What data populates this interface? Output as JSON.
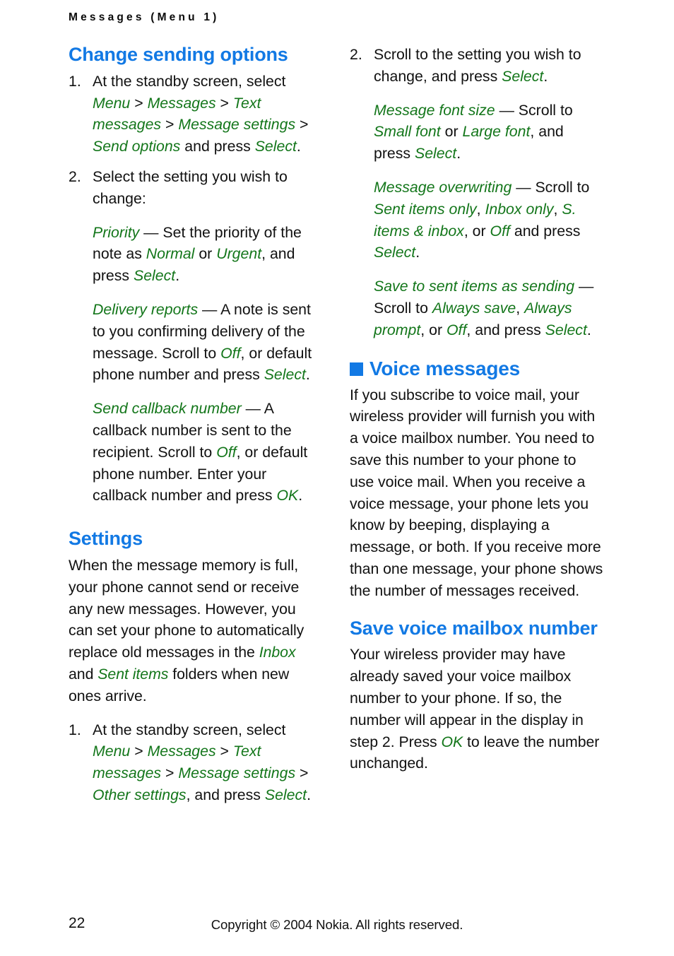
{
  "page": {
    "running_header": "Messages (Menu 1)",
    "page_number": "22",
    "copyright": "Copyright © 2004 Nokia. All rights reserved.",
    "colors": {
      "heading_blue": "#1279e4",
      "ui_term_green": "#13761a",
      "body_black": "#111111",
      "background": "#ffffff"
    }
  },
  "left_column": {
    "heading_change_sending": "Change sending options",
    "step1": {
      "number": "1.",
      "t1": "At the standby screen, select ",
      "ui1": "Menu",
      "t2": " > ",
      "ui2": "Messages",
      "t3": " > ",
      "ui3": "Text messages",
      "t4": " > ",
      "ui4": "Message settings",
      "t5": " > ",
      "ui5": "Send options",
      "t6": " and press ",
      "ui6": "Select",
      "t7": "."
    },
    "step2": {
      "number": "2.",
      "t1": "Select the setting you wish to change:"
    },
    "priority": {
      "term": "Priority",
      "t1": " — Set the priority of the note as ",
      "ui1": "Normal",
      "t2": " or ",
      "ui2": "Urgent",
      "t3": ", and press ",
      "ui3": "Select",
      "t4": "."
    },
    "delivery_reports": {
      "term": "Delivery reports",
      "t1": " — A note is sent to you confirming delivery of the message. Scroll to ",
      "ui1": "Off",
      "t2": ", or default phone number and press ",
      "ui2": "Select",
      "t3": "."
    },
    "send_callback": {
      "term": "Send callback number",
      "t1": " — A callback number is sent to the recipient. Scroll to ",
      "ui1": "Off",
      "t2": ",  or default phone number. Enter your callback number and press ",
      "ui2": "OK",
      "t3": "."
    },
    "heading_settings": "Settings",
    "settings_para": {
      "t1": "When the message memory is full, your phone cannot send or receive any new messages. However, you can set your phone to automatically replace old messages in the ",
      "ui1": "Inbox",
      "t2": " and ",
      "ui2": "Sent items",
      "t3": " folders when new ones arrive."
    },
    "settings_step1": {
      "number": "1.",
      "t1": "At the standby screen, select ",
      "ui1": "Menu",
      "t2": " > ",
      "ui2": "Messages",
      "t3": " > ",
      "ui3": "Text messages",
      "t4": " > ",
      "ui4": "Message settings",
      "t5": " > ",
      "ui5": "Other settings",
      "t6": ", and press ",
      "ui6": "Select",
      "t7": "."
    }
  },
  "right_column": {
    "step2": {
      "number": "2.",
      "t1": "Scroll to the setting you wish to change, and press ",
      "ui1": "Select",
      "t2": "."
    },
    "message_font_size": {
      "term": "Message font size",
      "t1": " — Scroll to ",
      "ui1": "Small font",
      "t2": " or ",
      "ui2": "Large font",
      "t3": ", and press ",
      "ui3": "Select",
      "t4": "."
    },
    "message_overwriting": {
      "term": "Message overwriting",
      "t1": " — Scroll to ",
      "ui1": "Sent items only",
      "t2": ", ",
      "ui2": "Inbox only",
      "t3": ", ",
      "ui3": "S. items & inbox",
      "t4": ", or ",
      "ui4": "Off",
      "t5": " and press ",
      "ui5": "Select",
      "t6": "."
    },
    "save_to_sent": {
      "term": "Save to sent items as sending",
      "t1": " — Scroll to ",
      "ui1": "Always save",
      "t2": ", ",
      "ui2": "Always prompt",
      "t3": ", or ",
      "ui3": "Off",
      "t4": ", and press ",
      "ui4": "Select",
      "t5": "."
    },
    "heading_voice_messages": "Voice messages",
    "voice_para": "If you subscribe to voice mail, your wireless provider will furnish you with a voice mailbox number. You need to save this number to your phone to use voice mail. When you receive a voice message, your phone lets you know by beeping, displaying a message, or both. If you receive more than one message, your phone shows the number of messages received.",
    "heading_save_voice_mailbox": "Save voice mailbox number",
    "save_voice_para": {
      "t1": "Your wireless provider may have already saved your voice mailbox number to your phone. If so, the number will appear in the display in step 2. Press ",
      "ui1": "OK",
      "t2": " to leave the number unchanged."
    }
  }
}
